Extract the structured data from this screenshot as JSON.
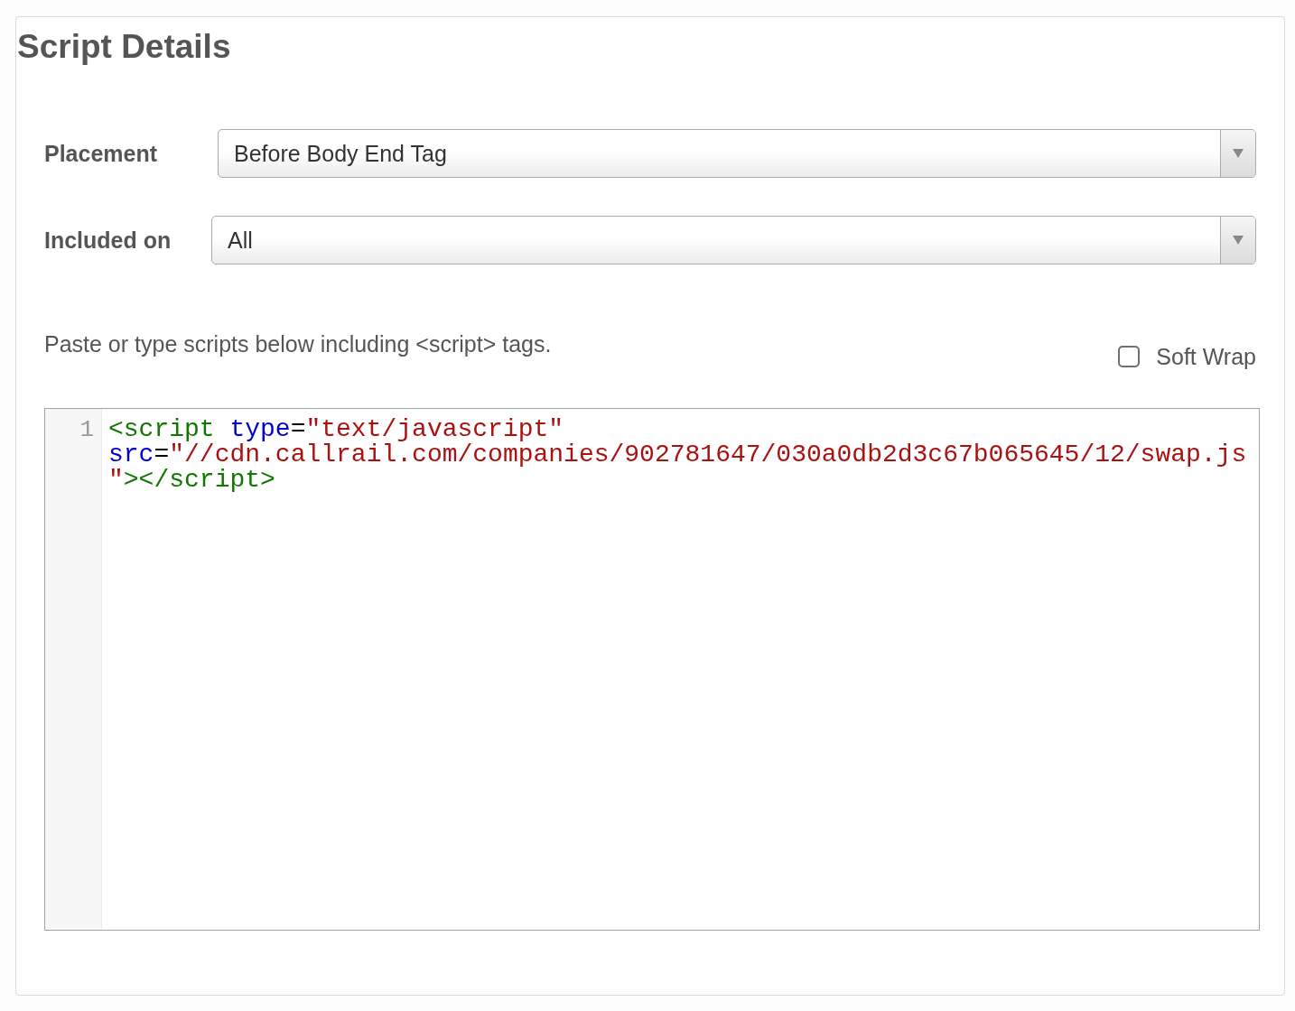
{
  "panel": {
    "title": "Script Details"
  },
  "fields": [
    {
      "label": "Placement",
      "value": "Before Body End Tag"
    },
    {
      "label": "Included on",
      "value": "All"
    }
  ],
  "instructions": "Paste or type scripts below including <script> tags.",
  "soft_wrap": {
    "label": "Soft Wrap",
    "checked": false
  },
  "editor": {
    "lines": [
      {
        "number": "1",
        "rows": [
          [
            {
              "kind": "tag",
              "text": "<script "
            },
            {
              "kind": "attribute",
              "text": "type"
            },
            {
              "kind": "operator",
              "text": "="
            },
            {
              "kind": "string",
              "text": "\"text/javascript\""
            }
          ],
          [
            {
              "kind": "attribute",
              "text": "src"
            },
            {
              "kind": "operator",
              "text": "="
            },
            {
              "kind": "string",
              "text": "\"//cdn.callrail.com/companies/902781647/030a0db2d3c67b065645/12/swap.js"
            }
          ],
          [
            {
              "kind": "string",
              "text": "\""
            },
            {
              "kind": "tag",
              "text": "></script>"
            }
          ]
        ]
      }
    ]
  }
}
